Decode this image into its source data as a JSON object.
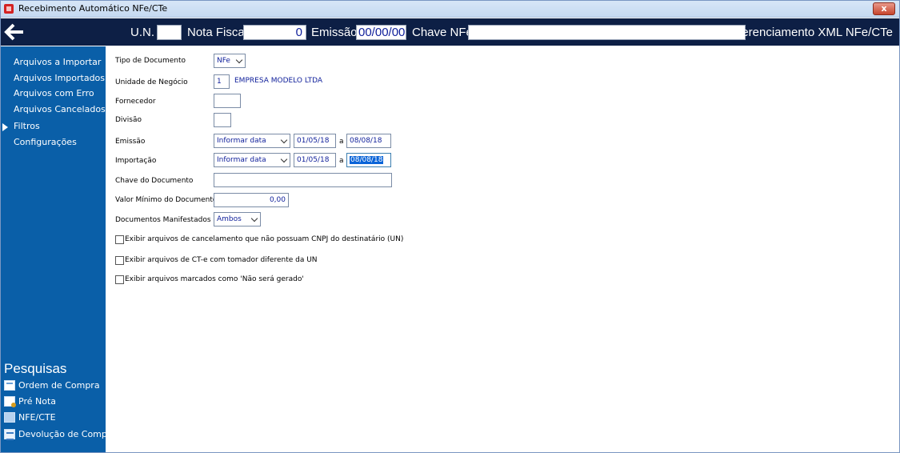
{
  "window": {
    "title": "Recebimento Automático NFe/CTe",
    "close_label": "x"
  },
  "header": {
    "un_label": "U.N.",
    "un_value": "",
    "nota_label": "Nota Fiscal",
    "nota_value": "0",
    "emissao_label": "Emissão",
    "emissao_value": "00/00/00",
    "chave_label": "Chave NFe",
    "chave_value": "",
    "right_title": "Gerenciamento XML NFe/CTe"
  },
  "sidebar": {
    "items": [
      {
        "label": "Arquivos a Importar"
      },
      {
        "label": "Arquivos Importados"
      },
      {
        "label": "Arquivos com Erro"
      },
      {
        "label": "Arquivos Cancelados"
      },
      {
        "label": "Filtros",
        "selected": true
      },
      {
        "label": "Configurações"
      }
    ],
    "pesquisas_title": "Pesquisas",
    "pesquisas": [
      {
        "label": "Ordem de Compra",
        "icon": "document-icon"
      },
      {
        "label": "Pré Nota",
        "icon": "note-icon"
      },
      {
        "label": "NFE/CTE",
        "icon": "stack-icon"
      },
      {
        "label": "Devolução de Compra",
        "icon": "grid-icon"
      }
    ]
  },
  "form": {
    "tipo_documento": {
      "label": "Tipo de Documento",
      "value": "NFe"
    },
    "unidade_negocio": {
      "label": "Unidade de Negócio",
      "value": "1",
      "name": "EMPRESA MODELO LTDA"
    },
    "fornecedor": {
      "label": "Fornecedor",
      "value": ""
    },
    "divisao": {
      "label": "Divisão",
      "value": ""
    },
    "emissao": {
      "label": "Emissão",
      "mode": "Informar data",
      "from": "01/05/18",
      "sep": "a",
      "to": "08/08/18"
    },
    "importacao": {
      "label": "Importação",
      "mode": "Informar data",
      "from": "01/05/18",
      "sep": "a",
      "to": "08/08/18"
    },
    "chave_documento": {
      "label": "Chave do Documento",
      "value": ""
    },
    "valor_minimo": {
      "label": "Valor Mínimo do Documento",
      "value": "0,00"
    },
    "documentos_manifestados": {
      "label": "Documentos Manifestados",
      "value": "Ambos"
    },
    "checkboxes": [
      {
        "label": "Exibir arquivos de cancelamento que não possuam CNPJ do destinatário (UN)",
        "checked": false
      },
      {
        "label": "Exibir arquivos de CT-e com tomador diferente da UN",
        "checked": false
      },
      {
        "label": "Exibir arquivos marcados como 'Não será gerado'",
        "checked": false
      }
    ]
  }
}
